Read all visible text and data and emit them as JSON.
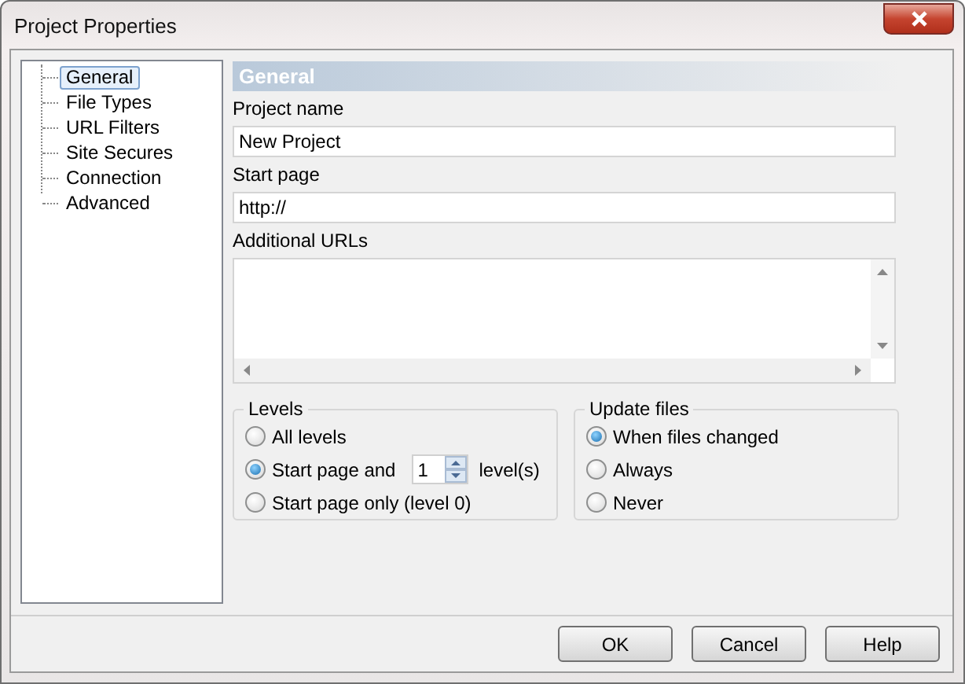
{
  "window": {
    "title": "Project Properties"
  },
  "tree": {
    "items": [
      {
        "label": "General",
        "selected": true
      },
      {
        "label": "File Types",
        "selected": false
      },
      {
        "label": "URL Filters",
        "selected": false
      },
      {
        "label": "Site Secures",
        "selected": false
      },
      {
        "label": "Connection",
        "selected": false
      },
      {
        "label": "Advanced",
        "selected": false
      }
    ]
  },
  "panel": {
    "header": "General",
    "fields": [
      {
        "label": "Project name",
        "value": "New Project"
      },
      {
        "label": "Start page",
        "value": "http://"
      }
    ],
    "additional_urls": {
      "label": "Additional URLs"
    }
  },
  "groups": [
    {
      "title": "Levels",
      "options": [
        {
          "kind": "plain",
          "label": "All levels",
          "selected": false
        },
        {
          "kind": "spin",
          "label": "Start page and",
          "value": "1",
          "suffix": "level(s)",
          "selected": true
        },
        {
          "kind": "plain",
          "label": "Start page only (level 0)",
          "selected": false
        }
      ]
    },
    {
      "title": "Update files",
      "options": [
        {
          "kind": "plain",
          "label": "When files changed",
          "selected": true
        },
        {
          "kind": "plain",
          "label": "Always",
          "selected": false
        },
        {
          "kind": "plain",
          "label": "Never",
          "selected": false
        }
      ]
    }
  ],
  "buttons": [
    "OK",
    "Cancel",
    "Help"
  ]
}
